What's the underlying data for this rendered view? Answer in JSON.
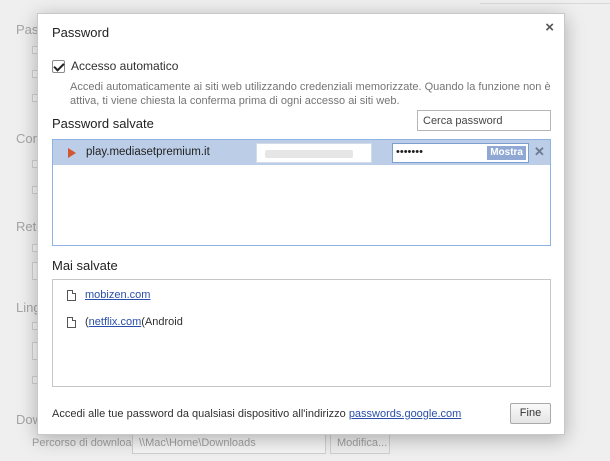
{
  "background": {
    "sections": [
      "Passw",
      "Con",
      "Rete",
      "Ling",
      "Dow"
    ],
    "download_label": "Percorso di download:",
    "download_path": "\\\\Mac\\Home\\Downloads",
    "change_button": "Modifica..."
  },
  "dialog": {
    "title": "Password",
    "close_label": "×",
    "auto_signin": {
      "label": "Accesso automatico",
      "checked": true,
      "description": "Accedi automaticamente ai siti web utilizzando credenziali memorizzate. Quando la funzione non è attiva, ti viene chiesta la conferma prima di ogni accesso ai siti web."
    },
    "saved_passwords": {
      "title": "Password salvate",
      "search_placeholder": "Cerca password",
      "rows": [
        {
          "site": "play.mediasetpremium.it",
          "password_mask": "•••••••",
          "show_label": "Mostra",
          "remove_label": "✕"
        }
      ]
    },
    "never_saved": {
      "title": "Mai salvate",
      "items": [
        {
          "prefix": "",
          "link": "mobizen.com",
          "suffix": ""
        },
        {
          "prefix": "(",
          "link": "netflix.com",
          "suffix": " (Android"
        }
      ]
    },
    "footer": {
      "text": "Accedi alle tue password da qualsiasi dispositivo all'indirizzo ",
      "link": "passwords.google.com",
      "done_label": "Fine"
    }
  }
}
